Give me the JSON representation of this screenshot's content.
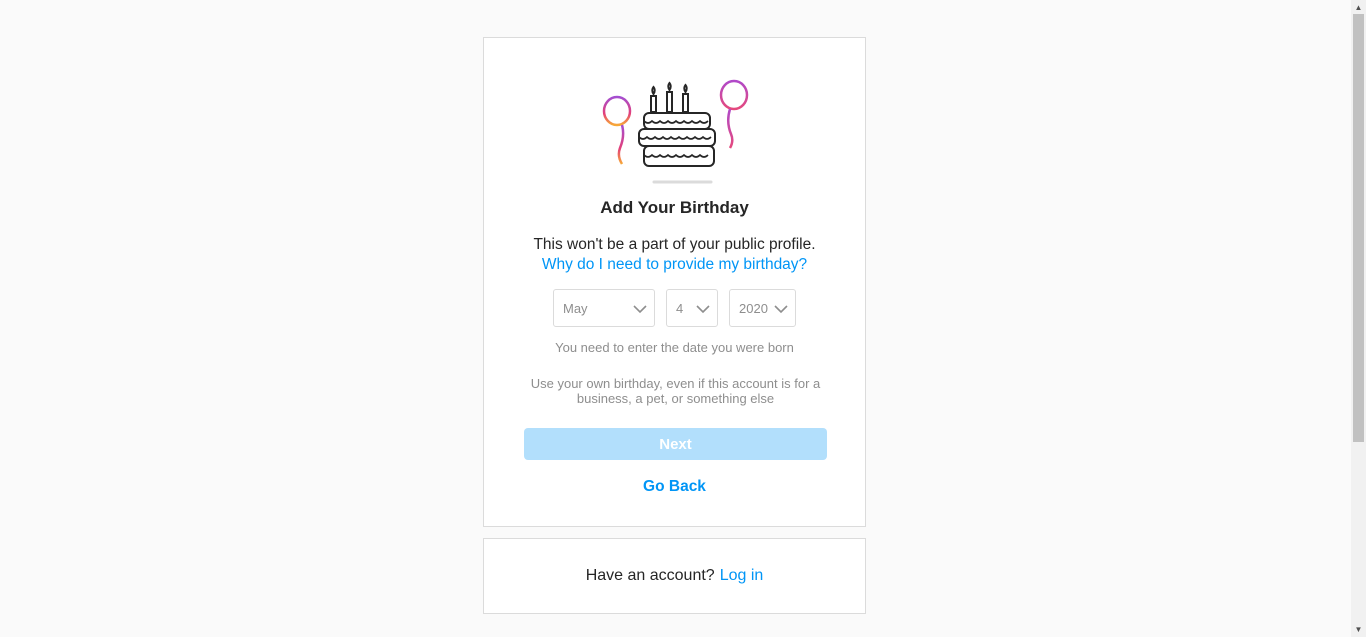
{
  "birthday": {
    "title": "Add Your Birthday",
    "subtitle": "This won't be a part of your public profile.",
    "why_link": "Why do I need to provide my birthday?",
    "month": "May",
    "day": "4",
    "year": "2020",
    "hint": "You need to enter the date you were born",
    "note": "Use your own birthday, even if this account is for a business, a pet, or something else",
    "next_label": "Next",
    "back_label": "Go Back"
  },
  "login": {
    "prompt": "Have an account?",
    "link": "Log in"
  },
  "icons": {
    "illustration": "birthday-cake-balloons-icon",
    "chevron": "chevron-down-icon",
    "scroll_up": "triangle-up-icon",
    "scroll_down": "triangle-down-icon"
  },
  "colors": {
    "accent": "#0095f6",
    "button_disabled": "#b2dffc",
    "border": "#dbdbdb",
    "muted_text": "#8e8e8e",
    "background": "#fafafa"
  }
}
